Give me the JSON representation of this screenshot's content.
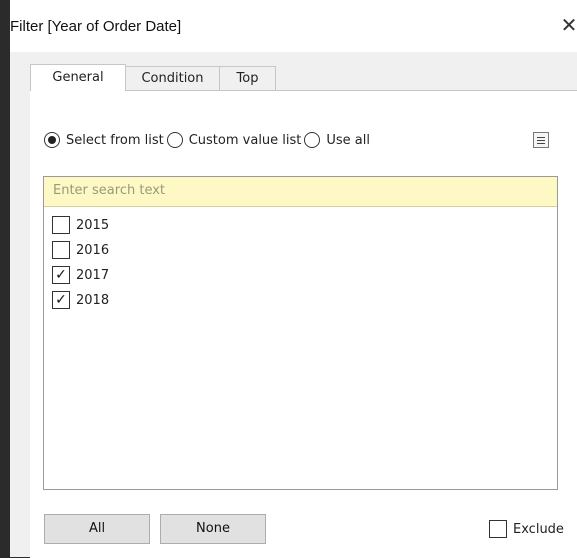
{
  "dialog": {
    "title": "Filter [Year of Order Date]",
    "close_glyph": "✕"
  },
  "tabs": [
    {
      "label": "General",
      "active": true
    },
    {
      "label": "Condition",
      "active": false
    },
    {
      "label": "Top",
      "active": false
    }
  ],
  "selection_mode": {
    "options": [
      {
        "label": "Select from list",
        "selected": true
      },
      {
        "label": "Custom value list",
        "selected": false
      },
      {
        "label": "Use all",
        "selected": false
      }
    ]
  },
  "search": {
    "placeholder": "Enter search text"
  },
  "years": [
    {
      "label": "2015",
      "checked": false
    },
    {
      "label": "2016",
      "checked": false
    },
    {
      "label": "2017",
      "checked": true
    },
    {
      "label": "2018",
      "checked": true
    }
  ],
  "buttons": {
    "all_label": "All",
    "none_label": "None"
  },
  "exclude": {
    "label": "Exclude",
    "checked": false
  },
  "check_glyph": "✓"
}
